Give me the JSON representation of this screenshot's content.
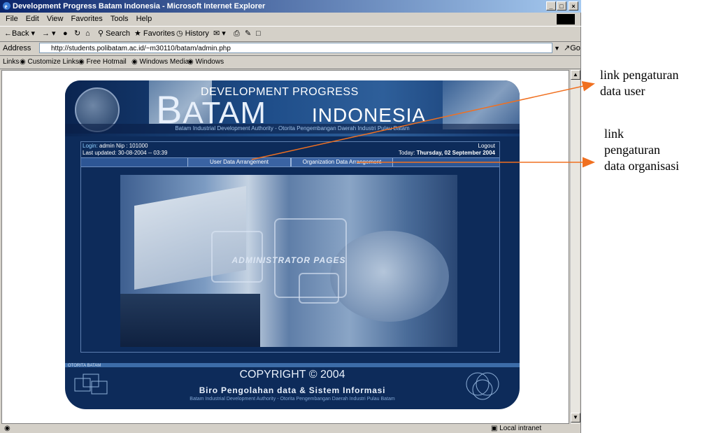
{
  "window": {
    "title": "Development Progress Batam Indonesia - Microsoft Internet Explorer",
    "controls": [
      "_",
      "□",
      "×"
    ]
  },
  "menu": [
    "File",
    "Edit",
    "View",
    "Favorites",
    "Tools",
    "Help"
  ],
  "toolbar": {
    "back": "Back",
    "search": "Search",
    "favorites": "Favorites",
    "history": "History"
  },
  "address": {
    "label": "Address",
    "url": "http://students.polibatam.ac.id/~m30110/batam/admin.php",
    "go": "Go"
  },
  "links": {
    "label": "Links",
    "items": [
      "Customize Links",
      "Free Hotmail",
      "Windows Media",
      "Windows"
    ]
  },
  "site": {
    "header": {
      "dev_progress": "DEVELOPMENT PROGRESS",
      "batam": "ATAM",
      "batam_initial": "B",
      "indonesia": "INDONESIA",
      "subtitle": "Batam Industrial Development Authority - Otorita Pengembangan Daerah Industri Pulau Batam"
    },
    "login_label": "Login:",
    "login_value": "admin Nip : 101000",
    "logout": "Logout",
    "last_updated": "Last updated: 30-08-2004 -- 03:39",
    "today_label": "Today:",
    "today_value": "Thursday, 02 September 2004",
    "nav": {
      "user_data": "User Data Arrangement",
      "org_data": "Organization Data Arrangement"
    },
    "hero_title": "ADMINISTRATOR PAGES",
    "footer": {
      "otorita": "OTORITA BATAM",
      "copyright": "COPYRIGHT © 2004",
      "biro": "Biro Pengolahan data & Sistem Informasi",
      "sub": "Batam Industrial Development Authority - Otorita Pengembangan Daerah Industri Pulau Batam"
    }
  },
  "status": {
    "zone": "Local intranet"
  },
  "annotations": {
    "user_link": [
      "link pengaturan",
      "data user"
    ],
    "org_link": [
      "link",
      "pengaturan",
      "data organisasi"
    ]
  },
  "colors": {
    "arrow": "#f07020",
    "site_bg": "#0d2b5a",
    "titlebar": "#0a246a"
  }
}
